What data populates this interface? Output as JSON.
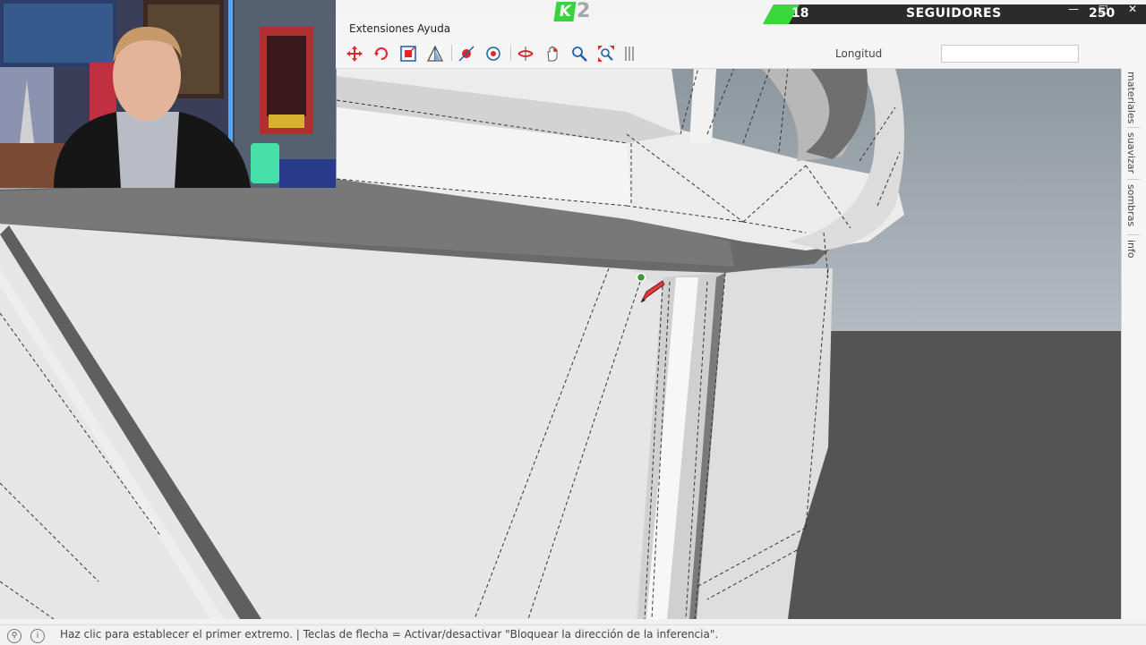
{
  "menu": {
    "extensions": "Extensiones",
    "help": "Ayuda"
  },
  "toolbar": {
    "tools": [
      "move-icon",
      "rotate-icon",
      "scale-icon",
      "flip-icon",
      "position-camera-icon",
      "look-around-icon",
      "section-plane-icon",
      "hand-pan-icon",
      "zoom-icon",
      "zoom-extents-icon",
      "more-icon"
    ],
    "measurement_label": "Longitud",
    "measurement_value": ""
  },
  "side_tabs": [
    "materiales",
    "suavizar",
    "sombras",
    "info"
  ],
  "status": {
    "text": "Haz clic para establecer el primer extremo. | Teclas de flecha = Activar/desactivar \"Bloquear la dirección de la inferencia\"."
  },
  "stream_overlay": {
    "badge_letter": "K",
    "badge_number": "2",
    "followers_current": "18",
    "followers_label": "SEGUIDORES",
    "followers_goal": "250",
    "followers_progress": 0.072,
    "accent_color": "#38d73b"
  },
  "colors": {
    "model_face_light": "#e2e2e2",
    "model_face_dark": "#6e6e6e",
    "ground": "#545454",
    "sky": "#9aa4ac"
  }
}
